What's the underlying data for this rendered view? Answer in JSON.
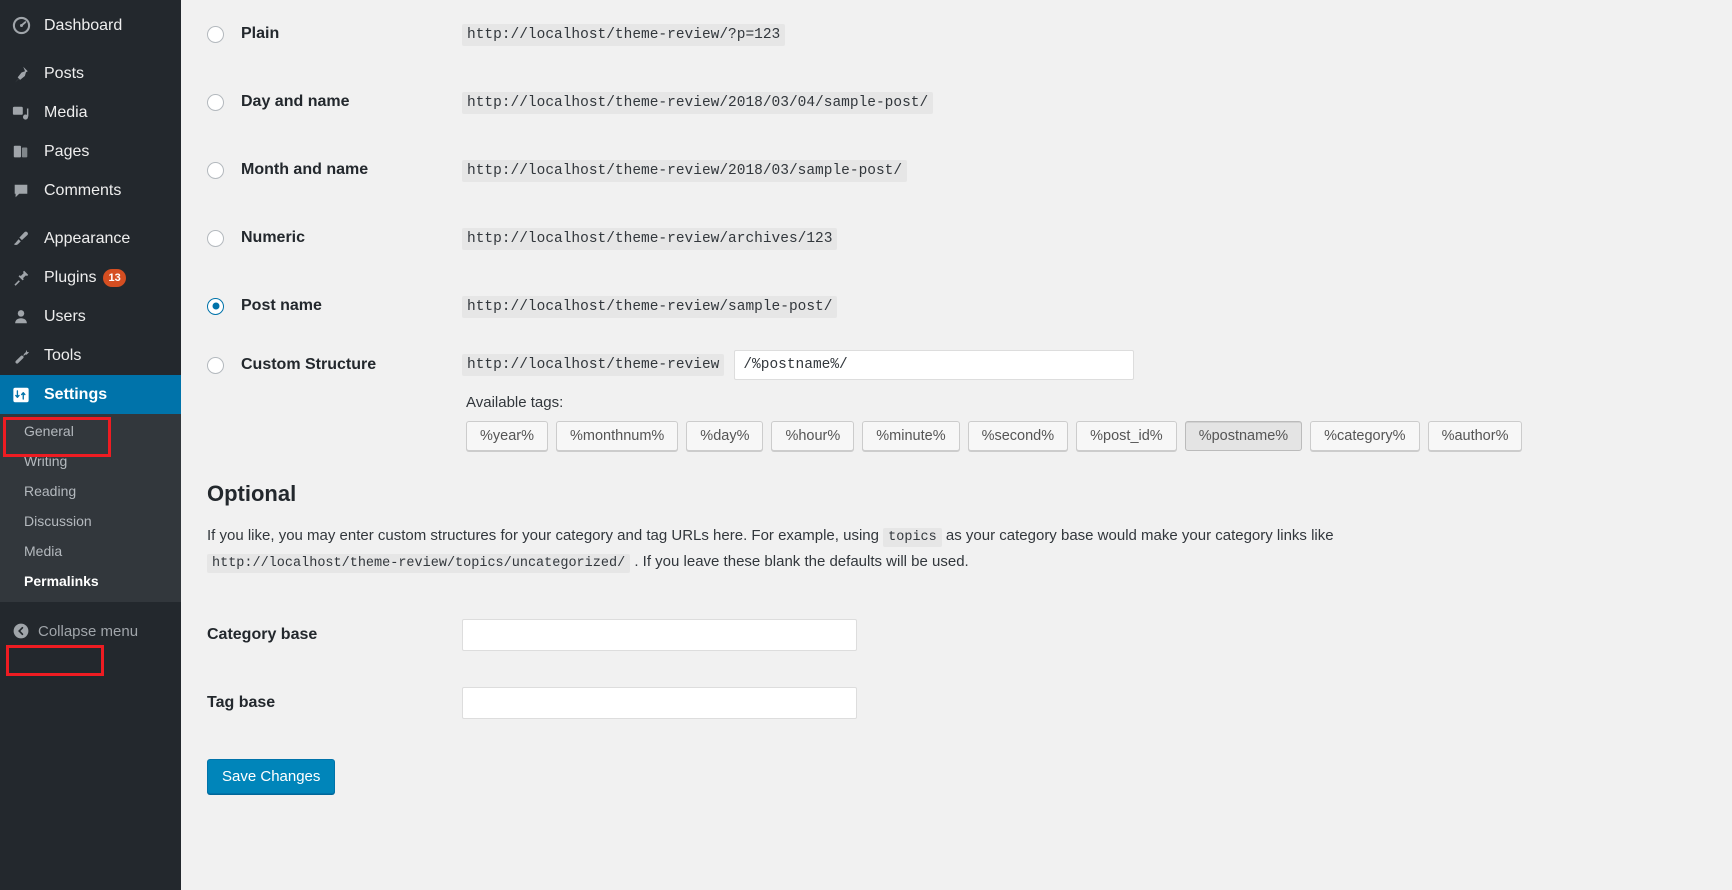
{
  "sidebar": {
    "items": [
      {
        "label": "Dashboard",
        "icon": "dashboard-icon",
        "badge": null
      },
      {
        "label": "Posts",
        "icon": "pin-icon",
        "badge": null
      },
      {
        "label": "Media",
        "icon": "media-icon",
        "badge": null
      },
      {
        "label": "Pages",
        "icon": "pages-icon",
        "badge": null
      },
      {
        "label": "Comments",
        "icon": "comment-icon",
        "badge": null
      },
      {
        "label": "Appearance",
        "icon": "brush-icon",
        "badge": null
      },
      {
        "label": "Plugins",
        "icon": "plug-icon",
        "badge": "13"
      },
      {
        "label": "Users",
        "icon": "user-icon",
        "badge": null
      },
      {
        "label": "Tools",
        "icon": "wrench-icon",
        "badge": null
      },
      {
        "label": "Settings",
        "icon": "settings-icon",
        "badge": null
      }
    ],
    "submenu": [
      {
        "label": "General"
      },
      {
        "label": "Writing"
      },
      {
        "label": "Reading"
      },
      {
        "label": "Discussion"
      },
      {
        "label": "Media"
      },
      {
        "label": "Permalinks"
      }
    ],
    "collapse_label": "Collapse menu",
    "collapse_icon": "collapse-arrow-icon",
    "highlight_color": "#ee1c22",
    "active_color": "#0073aa",
    "badge_color": "#d54e21"
  },
  "permalink_options": [
    {
      "label": "Plain",
      "url": "http://localhost/theme-review/?p=123"
    },
    {
      "label": "Day and name",
      "url": "http://localhost/theme-review/2018/03/04/sample-post/"
    },
    {
      "label": "Month and name",
      "url": "http://localhost/theme-review/2018/03/sample-post/"
    },
    {
      "label": "Numeric",
      "url": "http://localhost/theme-review/archives/123"
    },
    {
      "label": "Post name",
      "url": "http://localhost/theme-review/sample-post/"
    }
  ],
  "custom_structure": {
    "label": "Custom Structure",
    "prefix": "http://localhost/theme-review",
    "value": "/%postname%/",
    "placeholder": ""
  },
  "available_tags": {
    "label": "Available tags:",
    "tags": [
      "%year%",
      "%monthnum%",
      "%day%",
      "%hour%",
      "%minute%",
      "%second%",
      "%post_id%",
      "%postname%",
      "%category%",
      "%author%"
    ],
    "pressed_tag": "%postname%"
  },
  "optional": {
    "title": "Optional",
    "desc_part1": "If you like, you may enter custom structures for your category and tag URLs here. For example, using",
    "code_topics": "topics",
    "desc_part2": "as your category base would make your category links like",
    "code_url": "http://localhost/theme-review/topics/uncategorized/",
    "desc_part3": ". If you leave these blank the defaults will be used.",
    "category_base_label": "Category base",
    "category_base_value": "",
    "tag_base_label": "Tag base",
    "tag_base_value": ""
  },
  "save_button": {
    "label": "Save Changes",
    "color": "#0085ba"
  }
}
